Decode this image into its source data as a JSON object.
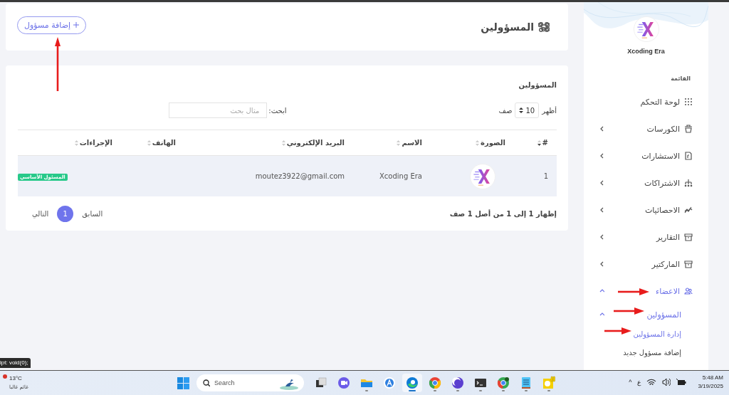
{
  "sidebar": {
    "brand": "Xcoding Era",
    "menu_heading": "القائمة",
    "items": [
      {
        "label": "لوحة التحكم",
        "selected": false
      },
      {
        "label": "الكورسات",
        "expanded": false,
        "selected": false
      },
      {
        "label": "الاستشارات",
        "expanded": false,
        "selected": false
      },
      {
        "label": "الاشتراكات",
        "expanded": false,
        "selected": false
      },
      {
        "label": "الاحصائيات",
        "expanded": false,
        "selected": false
      },
      {
        "label": "التقارير",
        "expanded": false,
        "selected": false
      },
      {
        "label": "الماركتير",
        "expanded": false,
        "selected": false
      },
      {
        "label": "الاعضاء",
        "expanded": true,
        "selected": true,
        "children": [
          {
            "label": "المسؤولين",
            "expanded": true,
            "selected": true,
            "children": [
              {
                "label": "إدارة المسؤولين",
                "selected": true
              },
              {
                "label": "إضافة مسؤول جديد",
                "selected": false
              }
            ]
          }
        ]
      }
    ]
  },
  "header": {
    "title": "المسؤولين",
    "add_button": "إضافة مسؤول"
  },
  "table_card": {
    "title": "المسؤولين",
    "length": {
      "before": "أظهر",
      "value": "10",
      "after": "صف"
    },
    "search": {
      "label": "ابحث:",
      "placeholder": "مثال بحث"
    },
    "columns": [
      {
        "label": "#",
        "sorted": true
      },
      {
        "label": "الصورة",
        "sorted": false
      },
      {
        "label": "الاسم",
        "sorted": false
      },
      {
        "label": "البريد الإلكتروني",
        "sorted": false
      },
      {
        "label": "الهاتف",
        "sorted": false
      },
      {
        "label": "الإجراءات",
        "sorted": false
      }
    ],
    "rows": [
      {
        "selected": true,
        "number": "1",
        "name": "Xcoding Era",
        "email": "moutez3922@gmail.com",
        "badge": "المسئول الأساسي"
      }
    ],
    "info": "إظهار 1 إلى 1 من أصل 1 صف",
    "pagination": {
      "previous": "السابق",
      "pages": [
        {
          "label": "1",
          "selected": true
        }
      ],
      "next": "التالي"
    }
  },
  "tooltip": "ipt: void(0);",
  "taskbar": {
    "weather": {
      "temperature": "13°C",
      "condition": "غائم غالبا"
    },
    "search_placeholder": "Search",
    "apps": [
      {
        "running": false,
        "active": false
      },
      {
        "running": false,
        "active": false
      },
      {
        "running": true,
        "active": false
      },
      {
        "running": false,
        "active": false
      },
      {
        "running": true,
        "active": true
      },
      {
        "running": true,
        "active": false
      },
      {
        "running": true,
        "active": false
      },
      {
        "running": true,
        "active": false
      },
      {
        "running": true,
        "active": false
      },
      {
        "running": true,
        "active": false
      },
      {
        "running": true,
        "active": false
      }
    ],
    "tray": {
      "overflow": "^",
      "language": "ع",
      "time": "5:48 AM",
      "date": "3/19/2025"
    }
  }
}
